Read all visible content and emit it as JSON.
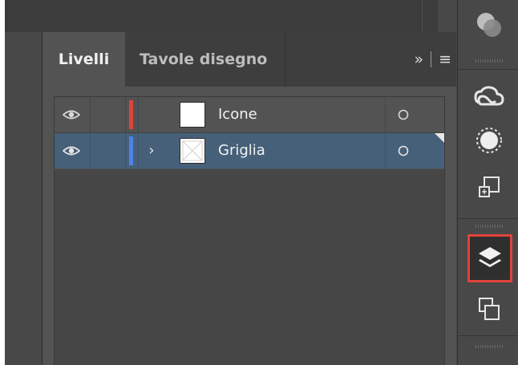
{
  "panel": {
    "tabs": [
      {
        "label": "Livelli",
        "active": true
      },
      {
        "label": "Tavole disegno",
        "active": false
      }
    ],
    "controls": {
      "expand_icon": "double-chevron-right-icon",
      "menu_icon": "hamburger-menu-icon"
    }
  },
  "layers": [
    {
      "name": "Icone",
      "visible": true,
      "color": "#e0433a",
      "expandable": false,
      "selected": false,
      "thumbnail": "white"
    },
    {
      "name": "Griglia",
      "visible": true,
      "color": "#4d82e8",
      "expandable": true,
      "selected": true,
      "thumbnail": "white-with-cross"
    }
  ],
  "dock": {
    "buttons": [
      {
        "icon": "shape-overlap-icon"
      },
      {
        "icon": "creative-cloud-icon"
      },
      {
        "icon": "appearance-circle-icon"
      },
      {
        "icon": "transform-artboard-icon"
      },
      {
        "icon": "layers-stack-icon",
        "highlighted": true
      },
      {
        "icon": "arrange-copies-icon"
      }
    ]
  },
  "colors": {
    "selected_row": "#46607a",
    "highlight_outline": "#e0433a",
    "panel_bg": "#535353"
  }
}
